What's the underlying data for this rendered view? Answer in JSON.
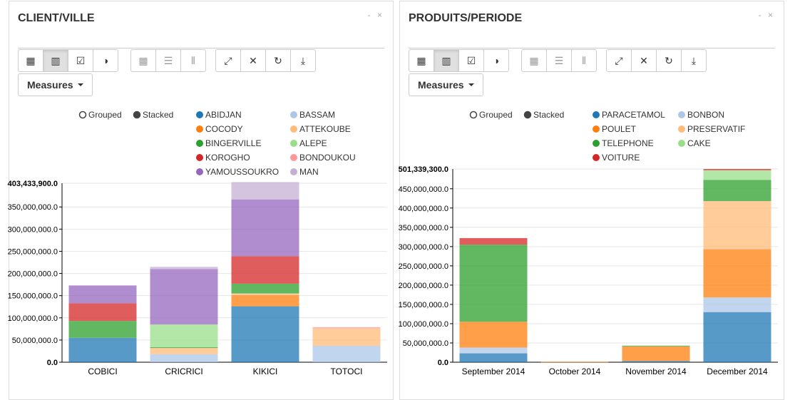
{
  "panels": [
    {
      "title": "CLIENT/VILLE",
      "controls": "- ×",
      "measures_label": "Measures",
      "legend_modes": [
        "Grouped",
        "Stacked"
      ],
      "chart_data": {
        "type": "bar",
        "stacked": true,
        "categories": [
          "COBICI",
          "CRICRICI",
          "KIKICI",
          "TOTOCI"
        ],
        "ylim": [
          0,
          403433900
        ],
        "yticks": [
          "0.0",
          "50,000,000.0",
          "100,000,000.0",
          "150,000,000.0",
          "200,000,000.0",
          "250,000,000.0",
          "300,000,000.0",
          "350,000,000.0"
        ],
        "ymax_label": "403,433,900.0",
        "grid": true,
        "series": [
          {
            "name": "ABIDJAN",
            "color": "#1f77b4",
            "values": [
              55000000,
              0,
              126000000,
              0
            ]
          },
          {
            "name": "BASSAM",
            "color": "#aec7e8",
            "values": [
              0,
              18000000,
              0,
              37000000
            ]
          },
          {
            "name": "COCODY",
            "color": "#ff7f0e",
            "values": [
              0,
              0,
              25000000,
              0
            ]
          },
          {
            "name": "ATTEKOUBE",
            "color": "#ffbb78",
            "values": [
              0,
              14000000,
              4000000,
              39000000
            ]
          },
          {
            "name": "BINGERVILLE",
            "color": "#2ca02c",
            "values": [
              38000000,
              2000000,
              22000000,
              0
            ]
          },
          {
            "name": "ALEPE",
            "color": "#98df8a",
            "values": [
              0,
              51000000,
              0,
              0
            ]
          },
          {
            "name": "KOROGHO",
            "color": "#d62728",
            "values": [
              40000000,
              0,
              62000000,
              0
            ]
          },
          {
            "name": "BONDOUKOU",
            "color": "#ff9896",
            "values": [
              0,
              0,
              0,
              3000000
            ]
          },
          {
            "name": "YAMOUSSOUKRO",
            "color": "#9467bd",
            "values": [
              40000000,
              125000000,
              128000000,
              0
            ]
          },
          {
            "name": "MAN",
            "color": "#c5b0d5",
            "values": [
              0,
              5000000,
              39000000,
              0
            ]
          }
        ]
      }
    },
    {
      "title": "PRODUITS/PERIODE",
      "controls": "- ×",
      "measures_label": "Measures",
      "legend_modes": [
        "Grouped",
        "Stacked"
      ],
      "chart_data": {
        "type": "bar",
        "stacked": true,
        "categories": [
          "September 2014",
          "October 2014",
          "November 2014",
          "December 2014"
        ],
        "ylim": [
          0,
          501339300
        ],
        "yticks": [
          "0.0",
          "50,000,000.0",
          "100,000,000.0",
          "150,000,000.0",
          "200,000,000.0",
          "250,000,000.0",
          "300,000,000.0",
          "350,000,000.0",
          "400,000,000.0",
          "450,000,000.0"
        ],
        "ymax_label": "501,339,300.0",
        "grid": true,
        "series": [
          {
            "name": "PARACETAMOL",
            "color": "#1f77b4",
            "values": [
              23000000,
              0,
              3000000,
              130000000
            ]
          },
          {
            "name": "BONBON",
            "color": "#aec7e8",
            "values": [
              15000000,
              0,
              0,
              38000000
            ]
          },
          {
            "name": "POULET",
            "color": "#ff7f0e",
            "values": [
              67000000,
              1000000,
              38000000,
              125000000
            ]
          },
          {
            "name": "PRESERVATIF",
            "color": "#ffbb78",
            "values": [
              0,
              0,
              0,
              125000000
            ]
          },
          {
            "name": "TELEPHONE",
            "color": "#2ca02c",
            "values": [
              200000000,
              0,
              2000000,
              55000000
            ]
          },
          {
            "name": "CAKE",
            "color": "#98df8a",
            "values": [
              0,
              0,
              0,
              25000000
            ]
          },
          {
            "name": "VOITURE",
            "color": "#d62728",
            "values": [
              17000000,
              0,
              0,
              3339300
            ]
          }
        ]
      }
    }
  ]
}
